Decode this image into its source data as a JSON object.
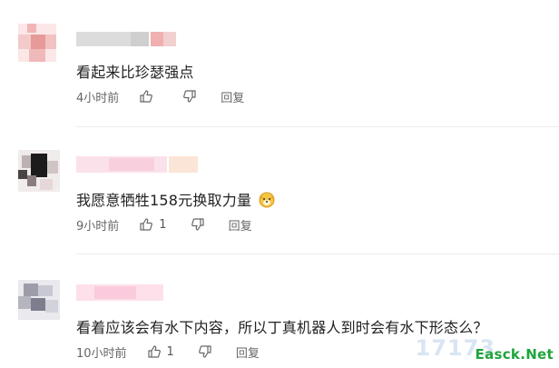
{
  "comments": [
    {
      "text": "看起来比珍瑟强点",
      "time": "4小时前",
      "likes": "",
      "reply_label": "回复",
      "avatar_colors": [
        "#f2c4c4",
        "#e9a3a3",
        "#f6dada",
        "#e8b0b0"
      ]
    },
    {
      "text": "我愿意牺牲158元换取力量",
      "emoji": "dog-face-emoji",
      "time": "9小时前",
      "likes": "1",
      "reply_label": "回复",
      "avatar_colors": [
        "#3a3a3a",
        "#9a8a8a",
        "#d9c9c9",
        "#1f1f1f"
      ]
    },
    {
      "text": "看着应该会有水下内容，所以丁真机器人到时会有水下形态么？",
      "time": "10小时前",
      "likes": "1",
      "reply_label": "回复",
      "avatar_colors": [
        "#b9b9c4",
        "#8f8f9f",
        "#d7d7de",
        "#c6c6d0"
      ]
    }
  ],
  "watermark": {
    "text": "Easck.Net",
    "faded": "17173"
  },
  "icons": {
    "like": "thumbs-up-icon",
    "dislike": "thumbs-down-icon"
  }
}
